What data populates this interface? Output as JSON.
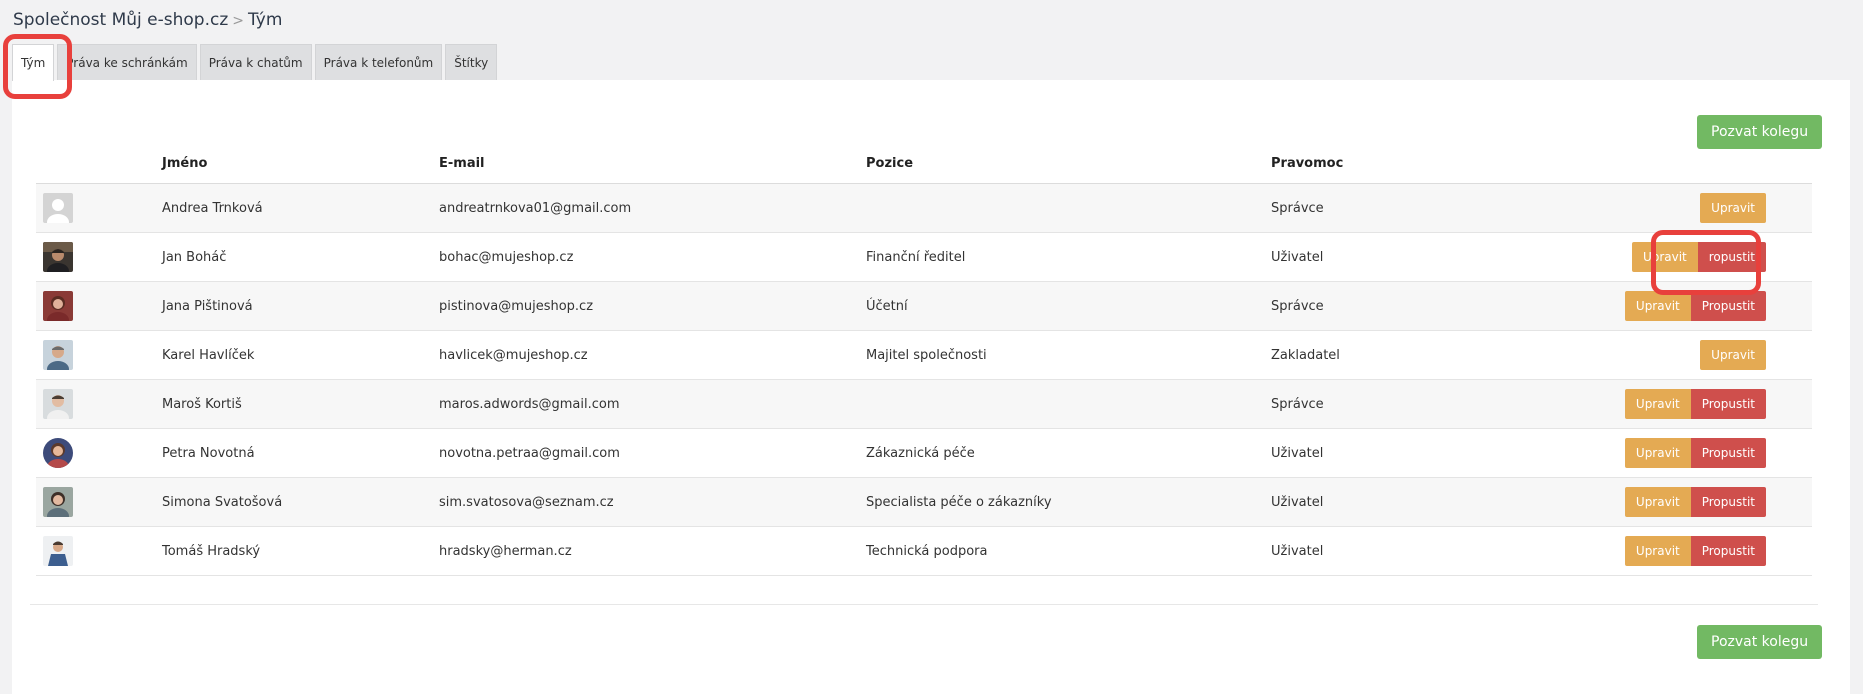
{
  "breadcrumb": {
    "company": "Společnost Můj e-shop.cz",
    "separator": ">",
    "current": "Tým"
  },
  "tabs": [
    {
      "label": "Tým",
      "active": true
    },
    {
      "label": "Práva ke schránkám"
    },
    {
      "label": "Práva k chatům"
    },
    {
      "label": "Práva k telefonům"
    },
    {
      "label": "Štítky"
    }
  ],
  "invite_button_label": "Pozvat kolegu",
  "table": {
    "headers": {
      "name": "Jméno",
      "email": "E-mail",
      "position": "Pozice",
      "permission": "Pravomoc"
    },
    "rows": [
      {
        "name": "Andrea Trnková",
        "email": "andreatrnkova01@gmail.com",
        "position": "",
        "permission": "Správce",
        "edit": "Upravit"
      },
      {
        "name": "Jan Boháč",
        "email": "bohac@mujeshop.cz",
        "position": "Finanční ředitel",
        "permission": "Uživatel",
        "edit": "Upravit",
        "fire": "ropustit"
      },
      {
        "name": "Jana Pištinová",
        "email": "pistinova@mujeshop.cz",
        "position": "Účetní",
        "permission": "Správce",
        "edit": "Upravit",
        "fire": "Propustit"
      },
      {
        "name": "Karel Havlíček",
        "email": "havlicek@mujeshop.cz",
        "position": "Majitel společnosti",
        "permission": "Zakladatel",
        "edit": "Upravit"
      },
      {
        "name": "Maroš Kortiš",
        "email": "maros.adwords@gmail.com",
        "position": "",
        "permission": "Správce",
        "edit": "Upravit",
        "fire": "Propustit"
      },
      {
        "name": "Petra Novotná",
        "email": "novotna.petraa@gmail.com",
        "position": "Zákaznická péče",
        "permission": "Uživatel",
        "edit": "Upravit",
        "fire": "Propustit"
      },
      {
        "name": "Simona Svatošová",
        "email": "sim.svatosova@seznam.cz",
        "position": "Specialista péče o zákazníky",
        "permission": "Uživatel",
        "edit": "Upravit",
        "fire": "Propustit"
      },
      {
        "name": "Tomáš Hradský",
        "email": "hradsky@herman.cz",
        "position": "Technická podpora",
        "permission": "Uživatel",
        "edit": "Upravit",
        "fire": "Propustit"
      }
    ]
  },
  "colors": {
    "invite": "#72b963",
    "edit": "#e4aa53",
    "fire": "#cf4f4c",
    "highlight": "#e8403c"
  }
}
